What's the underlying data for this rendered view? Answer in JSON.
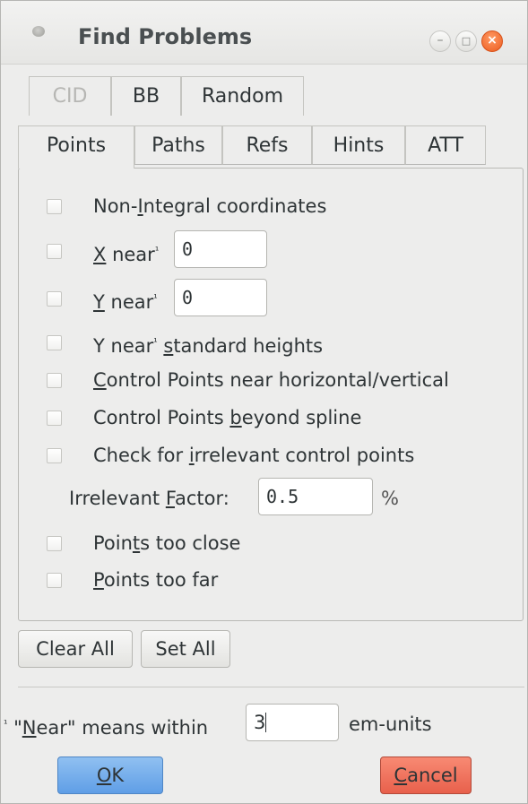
{
  "window": {
    "title": "Find Problems",
    "controls": {
      "minimize": "–",
      "maximize": "□",
      "close": "×"
    }
  },
  "tabs_row_top": [
    "CID",
    "BB",
    "Random"
  ],
  "tabs_row_bottom": [
    "Points",
    "Paths",
    "Refs",
    "Hints",
    "ATT"
  ],
  "active_tab": "Points",
  "options": {
    "non_integral": {
      "pre": "Non-",
      "key": "I",
      "post": "ntegral coordinates"
    },
    "x_near": {
      "key": "X",
      "post": " near",
      "sup": "¹",
      "value": "0"
    },
    "y_near": {
      "key": "Y",
      "post": " near",
      "sup": "¹",
      "value": "0"
    },
    "y_near_std": {
      "pre": "Y near",
      "sup": "¹",
      "mid": " ",
      "key": "s",
      "post": "tandard heights"
    },
    "cp_near_hv": {
      "key": "C",
      "post": "ontrol Points near horizontal/vertical"
    },
    "cp_beyond": {
      "pre": "Control Points ",
      "key": "b",
      "post": "eyond spline"
    },
    "irrelevant_cp": {
      "pre": "Check for ",
      "key": "i",
      "post": "rrelevant control points"
    },
    "irrelevant_factor": {
      "pre": "Irrelevant ",
      "key": "F",
      "post": "actor:",
      "value": "0.5",
      "unit": "%"
    },
    "points_too_close": {
      "pre": "Poin",
      "key": "t",
      "post": "s too close"
    },
    "points_too_far": {
      "key": "P",
      "post": "oints too far"
    }
  },
  "buttons": {
    "clear_all": "Clear All",
    "set_all": "Set All"
  },
  "footnote": {
    "mark": "¹",
    "pre": " \"",
    "key": "N",
    "post": "ear\" means within",
    "value": "3",
    "unit": "em-units"
  },
  "dialog_buttons": {
    "ok": {
      "key": "O",
      "post": "K"
    },
    "cancel": {
      "key": "C",
      "post": "ancel"
    }
  }
}
